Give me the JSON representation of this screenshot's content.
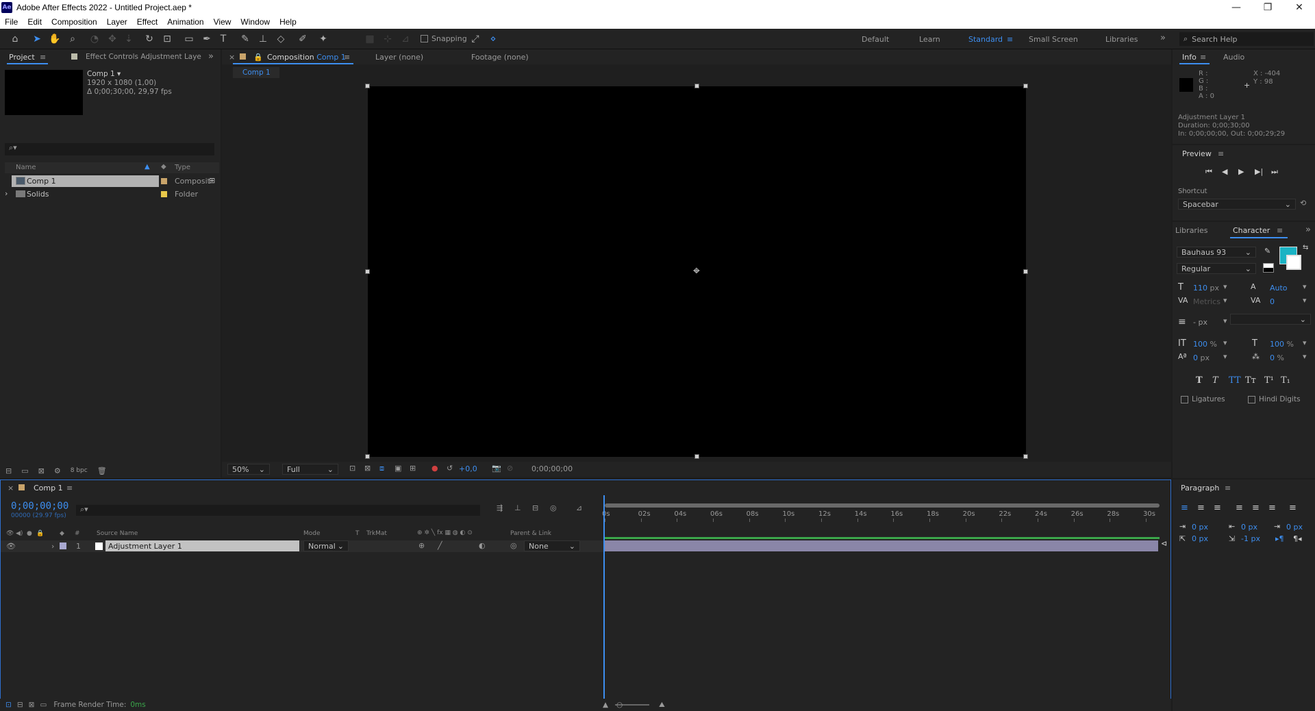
{
  "app": {
    "title": "Adobe After Effects 2022 - Untitled Project.aep *",
    "logo_text": "Ae"
  },
  "window_controls": {
    "minimize": "—",
    "maximize": "❐",
    "close": "✕"
  },
  "menu": [
    "File",
    "Edit",
    "Composition",
    "Layer",
    "Effect",
    "Animation",
    "View",
    "Window",
    "Help"
  ],
  "toolbar": {
    "snapping_label": "Snapping",
    "workspaces": [
      "Default",
      "Learn",
      "Standard",
      "Small Screen",
      "Libraries"
    ],
    "active_workspace": "Standard",
    "search_placeholder": "Search Help"
  },
  "project_panel": {
    "tab": "Project",
    "effect_controls_tab": "Effect Controls Adjustment Laye",
    "selected_item": {
      "name": "Comp 1",
      "size": "1920 x 1080 (1,00)",
      "duration": "Δ 0;00;30;00, 29,97 fps"
    },
    "columns": {
      "name": "Name",
      "type": "Type"
    },
    "items": [
      {
        "name": "Comp 1",
        "type": "Composit",
        "swatch": "#c9a46a"
      },
      {
        "name": "Solids",
        "type": "Folder",
        "swatch": "#e8c84a"
      }
    ],
    "bpc": "8 bpc"
  },
  "composition_panel": {
    "tab_prefix": "Composition",
    "tab_name": "Comp 1",
    "layer_tab": "Layer (none)",
    "footage_tab": "Footage (none)",
    "breadcrumb": "Comp 1",
    "zoom": "50%",
    "resolution": "Full",
    "exposure": "+0,0",
    "timecode": "0;00;00;00"
  },
  "info_panel": {
    "tab": "Info",
    "audio_tab": "Audio",
    "r": "R :",
    "g": "G :",
    "b": "B :",
    "a": "A : 0",
    "x": "X : -404",
    "y": "Y : 98",
    "layer_name": "Adjustment Layer 1",
    "duration": "Duration: 0;00;30;00",
    "in_out": "In: 0;00;00;00, Out: 0;00;29;29"
  },
  "preview_panel": {
    "tab": "Preview",
    "shortcut_label": "Shortcut",
    "shortcut_value": "Spacebar"
  },
  "character_panel": {
    "libraries_tab": "Libraries",
    "tab": "Character",
    "font": "Bauhaus 93",
    "style": "Regular",
    "size": "110",
    "size_unit": "px",
    "leading": "Auto",
    "kerning": "Metrics",
    "tracking": "0",
    "stroke": "- px",
    "vscale": "100",
    "vscale_unit": "%",
    "hscale": "100",
    "hscale_unit": "%",
    "baseline": "0",
    "baseline_unit": "px",
    "tsume": "0",
    "tsume_unit": "%",
    "ligatures": "Ligatures",
    "hindi_digits": "Hindi Digits",
    "fill_color": "#1ab3c4"
  },
  "paragraph_panel": {
    "tab": "Paragraph",
    "indent_left": "0 px",
    "indent_right": "0 px",
    "indent_first": "0 px",
    "space_before": "0 px",
    "space_after": "-1 px"
  },
  "timeline": {
    "tab": "Comp 1",
    "timecode": "0;00;00;00",
    "timecode_sub": "00000 (29.97 fps)",
    "columns": {
      "num": "#",
      "source_name": "Source Name",
      "mode": "Mode",
      "t": "T",
      "trkmat": "TrkMat",
      "parent": "Parent & Link"
    },
    "layers": [
      {
        "index": "1",
        "name": "Adjustment Layer 1",
        "mode": "Normal",
        "parent": "None"
      }
    ],
    "ruler": [
      "0s",
      "02s",
      "04s",
      "06s",
      "08s",
      "10s",
      "12s",
      "14s",
      "16s",
      "18s",
      "20s",
      "22s",
      "24s",
      "26s",
      "28s",
      "30s"
    ],
    "status_label": "Frame Render Time:",
    "status_value": "0ms"
  }
}
